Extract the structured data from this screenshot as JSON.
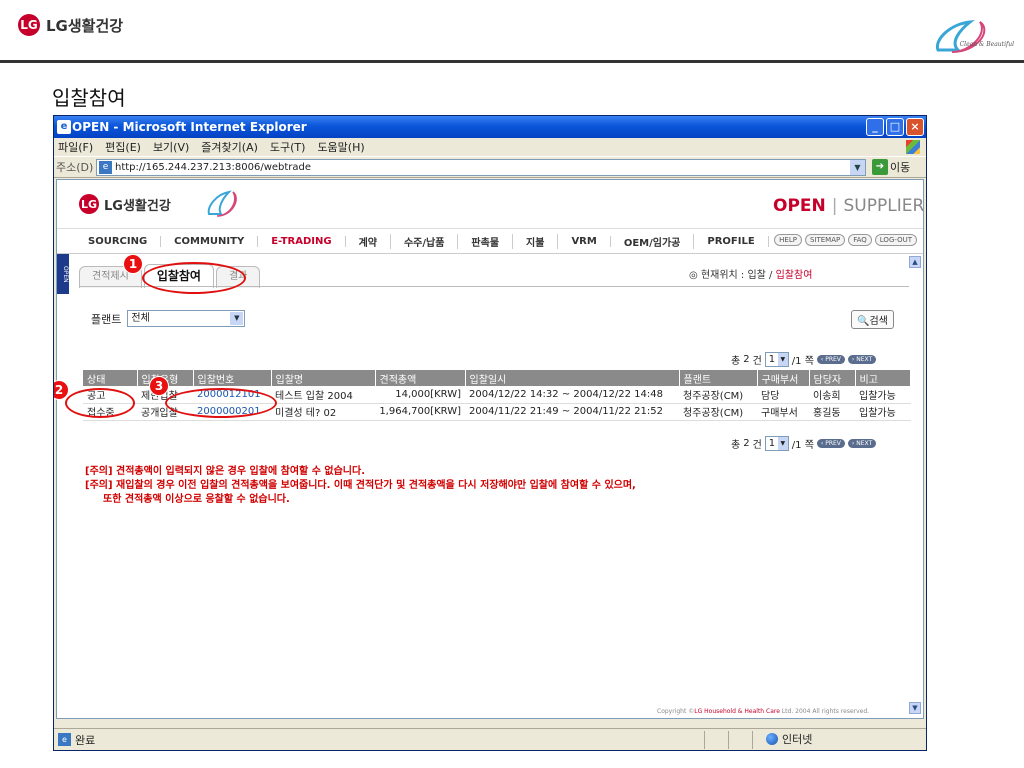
{
  "slide": {
    "brand": "LG생활건강",
    "brand_mark": "LG",
    "title": "입찰참여",
    "tagline": "Clean & Beautiful"
  },
  "window": {
    "title": "OPEN - Microsoft Internet Explorer",
    "controls": {
      "minimize": "_",
      "maximize": "□",
      "close": "×"
    },
    "menu": [
      "파일(F)",
      "편집(E)",
      "보기(V)",
      "즐겨찾기(A)",
      "도구(T)",
      "도움말(H)"
    ],
    "address_label": "주소(D)",
    "address": "http://165.244.237.213:8006/webtrade",
    "go_label": "이동"
  },
  "portal": {
    "brand": "LG생활건강",
    "open_label": "OPEN",
    "supplier_label": "SUPPLIER",
    "nav": [
      "SOURCING",
      "COMMUNITY",
      "E-TRADING",
      "계약",
      "수주/납품",
      "판촉물",
      "지불",
      "VRM",
      "OEM/임가공",
      "PROFILE"
    ],
    "active_nav": "E-TRADING",
    "util": [
      "HELP",
      "SITEMAP",
      "FAQ",
      "LOG-OUT"
    ],
    "side_tab": "OPEN",
    "tabs": [
      {
        "label": "견적제시"
      },
      {
        "label": "입찰참여"
      },
      {
        "label": "결과"
      }
    ],
    "location_prefix": "현재위치 : 입찰 /",
    "location_current": "입찰참여",
    "filter_label": "플랜트",
    "plant_value": "전체",
    "search_label": "검색",
    "pager": {
      "total_prefix": "총",
      "total_count": "2",
      "total_unit": "건",
      "page": "1",
      "page_suffix": "/1 쪽",
      "prev": "PREV",
      "next": "NEXT"
    },
    "table": {
      "headers": [
        "상태",
        "입찰유형",
        "입찰번호",
        "입찰명",
        "견적총액",
        "입찰일시",
        "플랜트",
        "구매부서",
        "담당자",
        "비고"
      ],
      "rows": [
        [
          "공고",
          "제한입찰",
          "2000012101",
          "테스트 입찰 2004",
          "14,000[KRW]",
          "2004/12/22 14:32 ~ 2004/12/22 14:48",
          "청주공장(CM)",
          "담당",
          "이송희",
          "입찰가능"
        ],
        [
          "접수중",
          "공개입찰",
          "2000000201",
          "미결성 테? 02",
          "1,964,700[KRW]",
          "2004/11/22 21:49 ~ 2004/11/22 21:52",
          "청주공장(CM)",
          "구매부서",
          "홍길동",
          "입찰가능"
        ]
      ]
    },
    "notices": [
      "[주의] 견적총액이 입력되지 않은 경우 입찰에 참여할 수 없습니다.",
      "[주의] 재입찰의 경우 이전 입찰의 견적총액을 보여줍니다. 이때 견적단가 및 견적총액을 다시 저장해야만 입찰에 참여할 수 있으며,",
      "또한 견적총액 이상으로 응찰할 수 없습니다."
    ],
    "copyright_prefix": "Copyright",
    "copyright_company": "LG Household & Health Care",
    "copyright_suffix": "Ltd. 2004 All rights reserved."
  },
  "status": {
    "text": "완료",
    "zone": "인터넷"
  },
  "annotations": [
    "1",
    "2",
    "3"
  ],
  "colors": {
    "brand_red": "#c6002a",
    "annotation_red": "#e01010",
    "link_blue": "#1a56b0"
  }
}
